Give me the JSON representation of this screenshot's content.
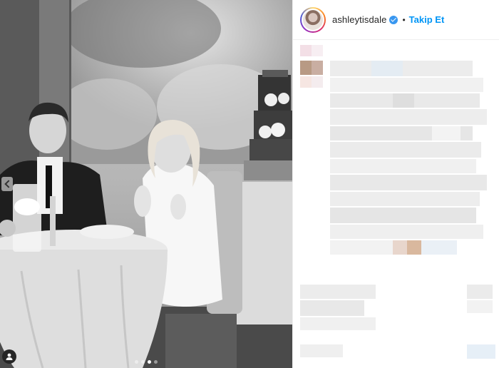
{
  "header": {
    "username": "ashleytisdale",
    "separator": "•",
    "follow_label": "Takip Et"
  },
  "icons": {
    "verified": "verified-badge-icon",
    "prev": "chevron-left-icon",
    "tags": "user-tag-icon"
  },
  "carousel": {
    "count": 4,
    "active_index": 2
  },
  "colors": {
    "follow": "#0095f6",
    "verified": "#3897f0",
    "divider": "#efefef"
  }
}
